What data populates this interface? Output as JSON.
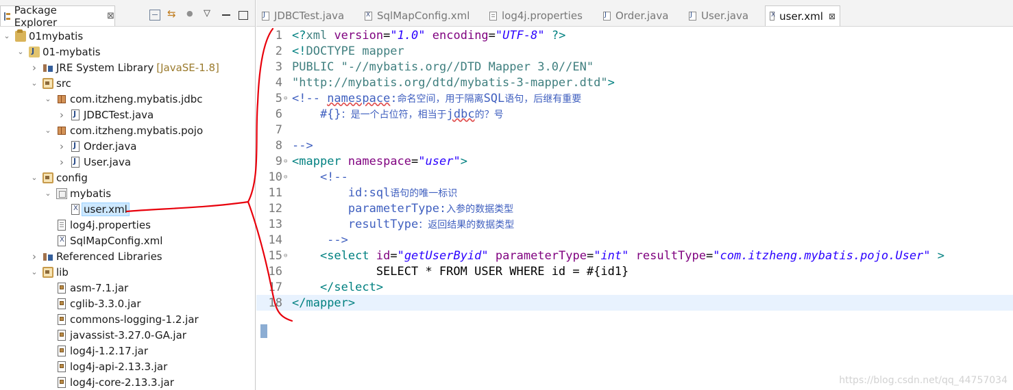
{
  "package_explorer": {
    "title": "Package Explorer",
    "close": "⊠",
    "tree": [
      {
        "label": "01mybatis",
        "icon": "project-folder-icon",
        "twisty": "expanded",
        "depth": 0
      },
      {
        "label": "01-mybatis",
        "icon": "java-project-icon",
        "twisty": "expanded",
        "depth": 1
      },
      {
        "label": "JRE System Library",
        "decoration": "[JavaSE-1.8]",
        "icon": "library-icon",
        "twisty": "collapsed",
        "depth": 2
      },
      {
        "label": "src",
        "icon": "source-folder-icon",
        "twisty": "expanded",
        "depth": 2
      },
      {
        "label": "com.itzheng.mybatis.jdbc",
        "icon": "package-icon",
        "twisty": "expanded",
        "depth": 3
      },
      {
        "label": "JDBCTest.java",
        "icon": "java-file-icon",
        "twisty": "collapsed",
        "depth": 4
      },
      {
        "label": "com.itzheng.mybatis.pojo",
        "icon": "package-icon",
        "twisty": "expanded",
        "depth": 3
      },
      {
        "label": "Order.java",
        "icon": "java-file-icon",
        "twisty": "collapsed",
        "depth": 4
      },
      {
        "label": "User.java",
        "icon": "java-file-icon",
        "twisty": "collapsed",
        "depth": 4
      },
      {
        "label": "config",
        "icon": "source-folder-icon",
        "twisty": "expanded",
        "depth": 2
      },
      {
        "label": "mybatis",
        "icon": "package-folder-icon",
        "twisty": "expanded",
        "depth": 3
      },
      {
        "label": "user.xml",
        "icon": "xml-file-icon",
        "twisty": "none",
        "depth": 4,
        "selected": true
      },
      {
        "label": "log4j.properties",
        "icon": "properties-file-icon",
        "twisty": "none",
        "depth": 3
      },
      {
        "label": "SqlMapConfig.xml",
        "icon": "xml-file-icon",
        "twisty": "none",
        "depth": 3
      },
      {
        "label": "Referenced Libraries",
        "icon": "library-icon",
        "twisty": "collapsed",
        "depth": 2
      },
      {
        "label": "lib",
        "icon": "folder-icon",
        "twisty": "expanded",
        "depth": 2
      },
      {
        "label": "asm-7.1.jar",
        "icon": "jar-file-icon",
        "twisty": "none",
        "depth": 3
      },
      {
        "label": "cglib-3.3.0.jar",
        "icon": "jar-file-icon",
        "twisty": "none",
        "depth": 3
      },
      {
        "label": "commons-logging-1.2.jar",
        "icon": "jar-file-icon",
        "twisty": "none",
        "depth": 3
      },
      {
        "label": "javassist-3.27.0-GA.jar",
        "icon": "jar-file-icon",
        "twisty": "none",
        "depth": 3
      },
      {
        "label": "log4j-1.2.17.jar",
        "icon": "jar-file-icon",
        "twisty": "none",
        "depth": 3
      },
      {
        "label": "log4j-api-2.13.3.jar",
        "icon": "jar-file-icon",
        "twisty": "none",
        "depth": 3
      },
      {
        "label": "log4j-core-2.13.3.jar",
        "icon": "jar-file-icon",
        "twisty": "none",
        "depth": 3
      }
    ]
  },
  "editor": {
    "tabs": [
      {
        "label": "JDBCTest.java",
        "icon": "java-file-icon",
        "active": false
      },
      {
        "label": "SqlMapConfig.xml",
        "icon": "xml-file-icon",
        "active": false
      },
      {
        "label": "log4j.properties",
        "icon": "properties-file-icon",
        "active": false
      },
      {
        "label": "Order.java",
        "icon": "java-file-icon",
        "active": false
      },
      {
        "label": "User.java",
        "icon": "java-file-icon",
        "active": false
      },
      {
        "label": "user.xml",
        "icon": "xml-file-icon",
        "active": true,
        "close": "⊠"
      }
    ],
    "current_line": 18,
    "lines": [
      {
        "n": "1",
        "fold": false,
        "segments": [
          [
            "punct",
            "<?"
          ],
          [
            "tag",
            "xml "
          ],
          [
            "attr",
            "version"
          ],
          [
            "txt",
            "="
          ],
          [
            "val",
            "\"1.0\""
          ],
          [
            "txt",
            " "
          ],
          [
            "attr",
            "encoding"
          ],
          [
            "txt",
            "="
          ],
          [
            "val",
            "\"UTF-8\""
          ],
          [
            "txt",
            " "
          ],
          [
            "punct",
            "?>"
          ]
        ]
      },
      {
        "n": "2",
        "fold": false,
        "segments": [
          [
            "punct",
            "<!"
          ],
          [
            "tag",
            "DOCTYPE mapper"
          ]
        ]
      },
      {
        "n": "3",
        "fold": false,
        "segments": [
          [
            "tag",
            "PUBLIC "
          ],
          [
            "str",
            "\"-//mybatis.org//DTD Mapper 3.0//EN\""
          ]
        ]
      },
      {
        "n": "4",
        "fold": false,
        "segments": [
          [
            "str",
            "\"http://mybatis.org/dtd/mybatis-3-mapper.dtd\""
          ],
          [
            "punct",
            ">"
          ]
        ]
      },
      {
        "n": "5",
        "fold": true,
        "segments": [
          [
            "comm",
            "<!-- "
          ],
          [
            "commul",
            "namespace"
          ],
          [
            "comm",
            ":"
          ],
          [
            "cn",
            "命名空间，用于隔离"
          ],
          [
            "comm",
            "SQL"
          ],
          [
            "cn",
            "语句，后继有重要"
          ]
        ]
      },
      {
        "n": "6",
        "fold": false,
        "segments": [
          [
            "comm",
            "    #{}"
          ],
          [
            "cn",
            "：是一个占位符，相当于"
          ],
          [
            "commul",
            "jdbc"
          ],
          [
            "cn",
            "的？号"
          ]
        ]
      },
      {
        "n": "7",
        "fold": false,
        "segments": []
      },
      {
        "n": "8",
        "fold": false,
        "segments": [
          [
            "comm",
            "-->"
          ]
        ]
      },
      {
        "n": "9",
        "fold": true,
        "segments": [
          [
            "punct",
            "<"
          ],
          [
            "tag2",
            "mapper "
          ],
          [
            "attr",
            "namespace"
          ],
          [
            "txt",
            "="
          ],
          [
            "val",
            "\"user\""
          ],
          [
            "punct",
            ">"
          ]
        ]
      },
      {
        "n": "10",
        "fold": true,
        "segments": [
          [
            "comm",
            "    <!--"
          ]
        ]
      },
      {
        "n": "11",
        "fold": false,
        "segments": [
          [
            "comm",
            "        id:sql"
          ],
          [
            "cn",
            "语句的唯一标识"
          ]
        ]
      },
      {
        "n": "12",
        "fold": false,
        "segments": [
          [
            "comm",
            "        parameterType:"
          ],
          [
            "cn",
            "入参的数据类型"
          ]
        ]
      },
      {
        "n": "13",
        "fold": false,
        "segments": [
          [
            "comm",
            "        resultType"
          ],
          [
            "cn",
            "：返回结果的数据类型"
          ]
        ]
      },
      {
        "n": "14",
        "fold": false,
        "segments": [
          [
            "comm",
            "     -->"
          ]
        ]
      },
      {
        "n": "15",
        "fold": true,
        "segments": [
          [
            "punct",
            "    <"
          ],
          [
            "tag2",
            "select "
          ],
          [
            "attr",
            "id"
          ],
          [
            "txt",
            "="
          ],
          [
            "val",
            "\"getUserByid\""
          ],
          [
            "txt",
            " "
          ],
          [
            "attr",
            "parameterType"
          ],
          [
            "txt",
            "="
          ],
          [
            "val",
            "\"int\""
          ],
          [
            "txt",
            " "
          ],
          [
            "attr",
            "resultType"
          ],
          [
            "txt",
            "="
          ],
          [
            "val",
            "\"com.itzheng.mybatis.pojo.User\""
          ],
          [
            "txt",
            " "
          ],
          [
            "punct",
            ">"
          ]
        ]
      },
      {
        "n": "16",
        "fold": false,
        "segments": [
          [
            "sql",
            "            SELECT * FROM USER WHERE id = #{id1}"
          ]
        ]
      },
      {
        "n": "17",
        "fold": false,
        "segments": [
          [
            "punct",
            "    </"
          ],
          [
            "tag2",
            "select"
          ],
          [
            "punct",
            ">"
          ]
        ]
      },
      {
        "n": "18",
        "fold": false,
        "segments": [
          [
            "punct",
            "</"
          ],
          [
            "tag2",
            "mapper"
          ],
          [
            "punct",
            ">"
          ]
        ]
      }
    ]
  },
  "watermark": "https://blog.csdn.net/qq_44757034",
  "colors": {
    "annotation_stroke": "#e8000b",
    "selection_bg": "#cde8ff",
    "current_line_bg": "#e8f2fe"
  }
}
